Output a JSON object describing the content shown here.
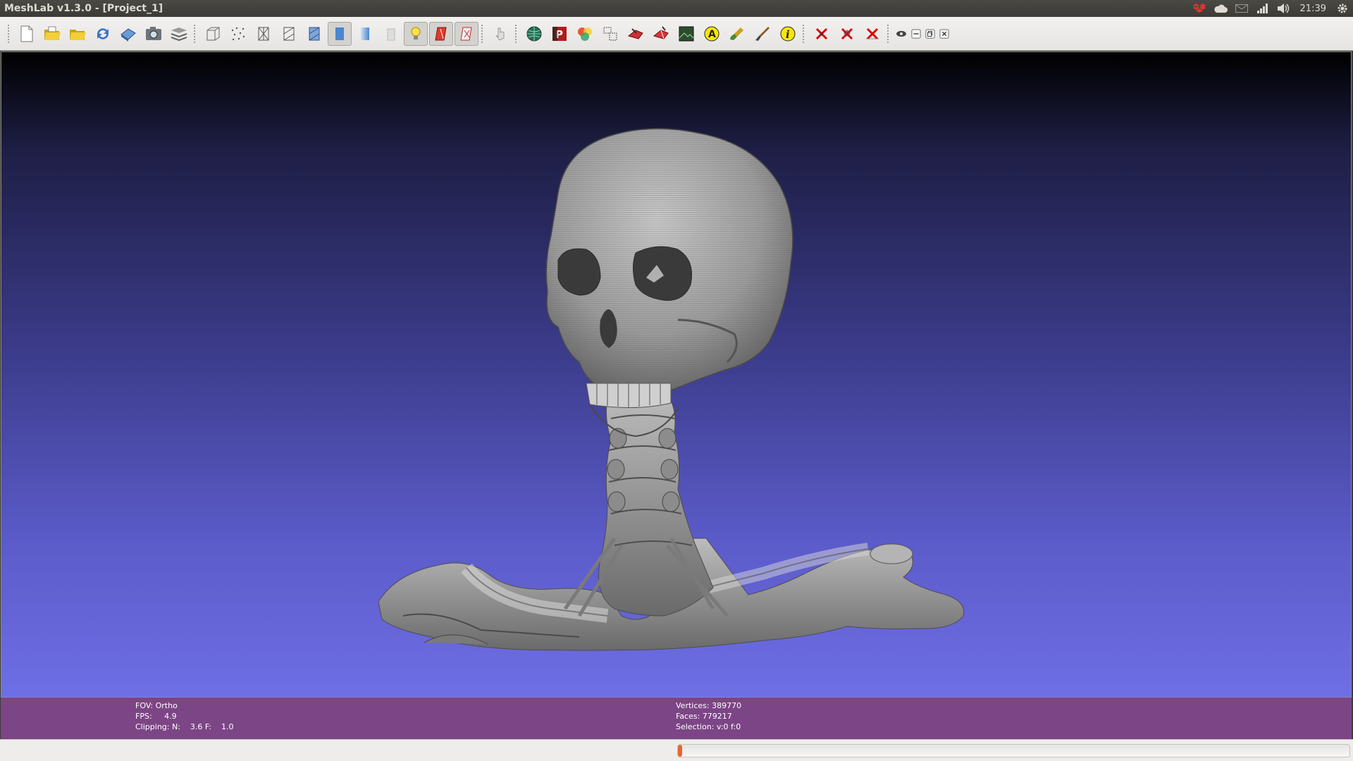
{
  "window": {
    "title": "MeshLab v1.3.0 - [Project_1]"
  },
  "tray": {
    "icons": [
      "dropbox-icon",
      "cloud-icon",
      "mail-icon",
      "network-signal-icon",
      "volume-icon"
    ],
    "clock": "21:39",
    "session_icon": "gear-icon"
  },
  "toolbar": {
    "groups": [
      [
        "new-document",
        "open-project",
        "open-mesh",
        "reload",
        "save-snapshot",
        "screenshot",
        "layers"
      ],
      [
        "bounding-box",
        "points",
        "wireframe",
        "hidden-lines",
        "flat-lines",
        "flat",
        "smooth",
        "texture",
        "lighting",
        "double-side-lighting",
        "back-face"
      ],
      [
        "manipulator"
      ],
      [
        "sphere-mesh",
        "pdf-render",
        "colorize",
        "align",
        "select-vertex",
        "select-faces",
        "raster-image",
        "annotate",
        "paint-brush",
        "fix-brush",
        "info"
      ],
      [
        "delete-vertices",
        "delete-faces",
        "delete-all"
      ],
      [
        "scene-view",
        "window-minimize",
        "window-restore",
        "window-close"
      ]
    ]
  },
  "info": {
    "fov": "FOV: Ortho",
    "fps": "FPS:     4.9",
    "clipping": "Clipping: N:    3.6 F:    1.0",
    "vertices": "Vertices: 389770",
    "faces": "Faces: 779217",
    "selection": "Selection: v:0 f:0"
  },
  "progress": {
    "value": 0.005
  },
  "colors": {
    "panel": "#3c3b37",
    "info_bg": "#7c4586",
    "viewport_top": "#000000",
    "viewport_bottom": "#6f6fe6",
    "progress_fill": "#e9652b"
  }
}
